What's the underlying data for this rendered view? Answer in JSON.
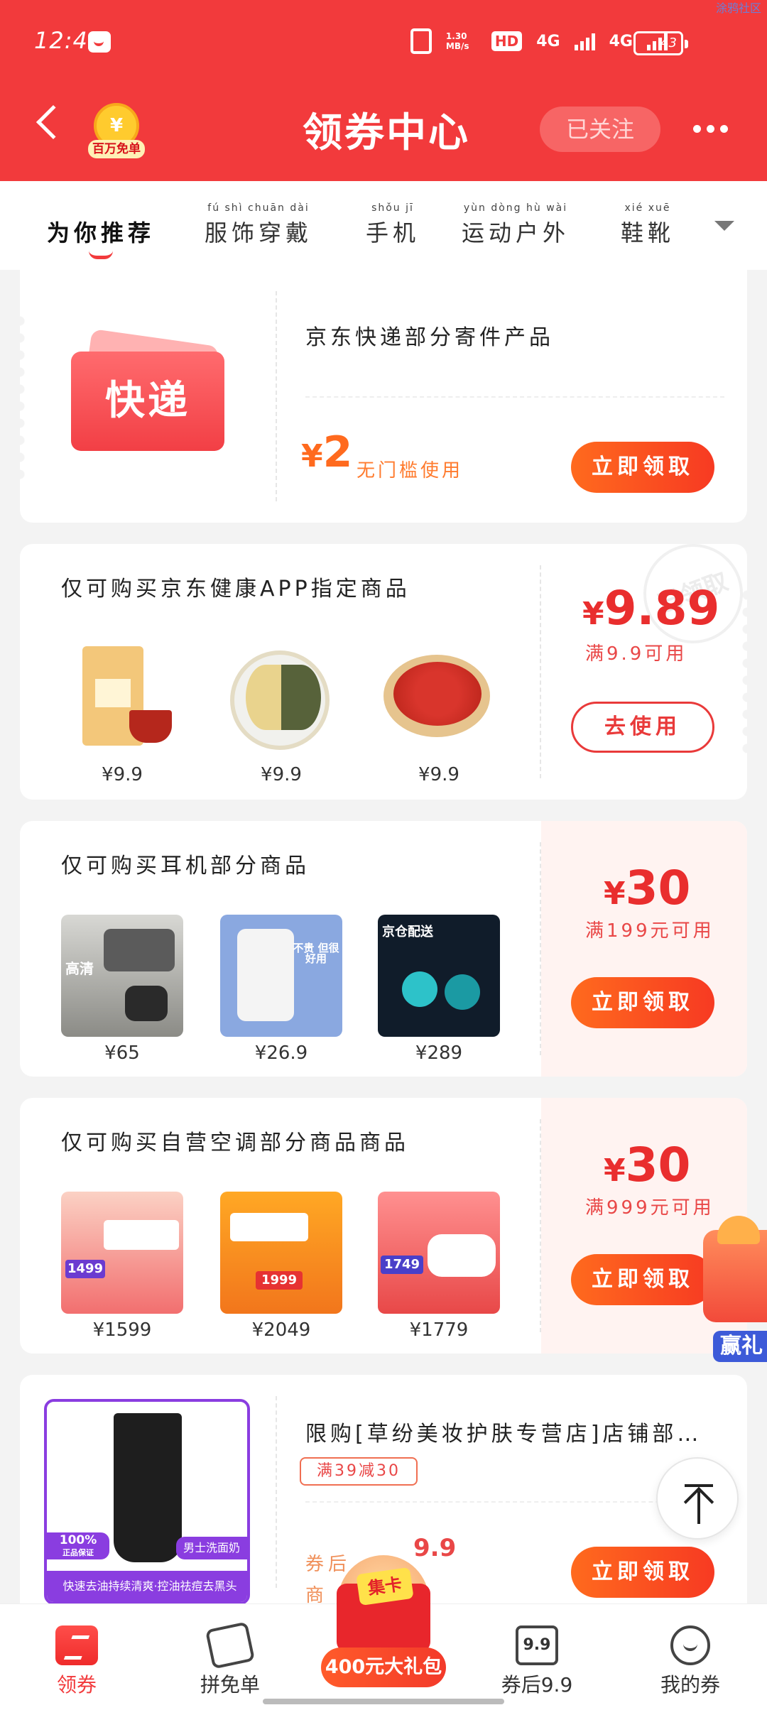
{
  "status": {
    "time": "12:42",
    "net_speed": "1.30 MB/s",
    "hd": "HD",
    "signal1": "4G",
    "signal2": "4G",
    "battery": "43",
    "watermark": "涂鸦社区"
  },
  "header": {
    "title": "领券中心",
    "badge_text": "百万免单",
    "badge_symbol": "¥",
    "follow_label": "已关注"
  },
  "tabs": [
    {
      "label": "为你推荐",
      "pinyin": "",
      "active": true
    },
    {
      "label": "服饰穿戴",
      "pinyin": "fú shì chuān dài",
      "active": false
    },
    {
      "label": "手机",
      "pinyin": "shǒu jī",
      "active": false
    },
    {
      "label": "运动户外",
      "pinyin": "yùn dòng hù wài",
      "active": false
    },
    {
      "label": "鞋靴",
      "pinyin": "xié xuē",
      "active": false
    }
  ],
  "coupons": [
    {
      "title": "京东快递部分寄件产品",
      "ticket_label": "快递",
      "amount": "2",
      "currency": "¥",
      "condition": "无门槛使用",
      "cta": "立即领取"
    },
    {
      "title": "仅可购买京东健康APP指定商品",
      "amount": "9.89",
      "currency": "¥",
      "condition": "满9.9可用",
      "cta": "去使用",
      "stamp": "已领取",
      "products": [
        {
          "price": "¥9.9"
        },
        {
          "price": "¥9.9"
        },
        {
          "price": "¥9.9"
        }
      ]
    },
    {
      "title": "仅可购买耳机部分商品",
      "amount": "30",
      "currency": "¥",
      "condition": "满199元可用",
      "cta": "立即领取",
      "products": [
        {
          "price": "¥65",
          "tag": "高清"
        },
        {
          "price": "¥26.9",
          "tag": "不贵 但很好用"
        },
        {
          "price": "¥289",
          "tag": "京仓配送"
        }
      ]
    },
    {
      "title": "仅可购买自营空调部分商品商品",
      "amount": "30",
      "currency": "¥",
      "condition": "满999元可用",
      "cta": "立即领取",
      "products": [
        {
          "price": "¥1599",
          "tag": "1499"
        },
        {
          "price": "¥2049",
          "tag": "1999"
        },
        {
          "price": "¥1779",
          "tag": "1749"
        }
      ]
    },
    {
      "title": "限购[草纷美妆护肤专营店]店铺部…",
      "condition": "满39减30",
      "amount_label": "券后",
      "amount": "9.9",
      "prefix": "商",
      "cta": "立即领取",
      "product_caption": "快速去油持续清爽·控油祛痘去黑头",
      "product_tag_left": "100%",
      "product_tag_left_sub": "正品保证",
      "product_tag_right": "男士洗面奶"
    }
  ],
  "floating": {
    "prize_label": "赢礼",
    "bundle_label": "400元大礼包",
    "bundle_card": "集卡"
  },
  "bottom_nav": [
    {
      "label": "领券",
      "icon": "coupon-icon",
      "active": true
    },
    {
      "label": "拼免单",
      "icon": "wallet-icon",
      "active": false
    },
    {
      "label": "券后9.9",
      "icon": "tag-99-icon",
      "icon_text": "9.9",
      "active": false
    },
    {
      "label": "我的券",
      "icon": "smile-icon",
      "active": false
    }
  ],
  "colors": {
    "brand": "#f23a3c",
    "cta_start": "#ff6a1e",
    "cta_end": "#f73a22",
    "price": "#e92e2e"
  }
}
